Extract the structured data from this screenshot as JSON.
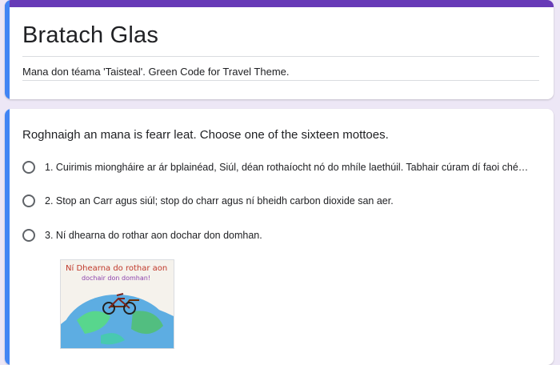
{
  "header": {
    "title": "Bratach Glas",
    "description": "Mana don téama 'Taisteal'. Green Code for Travel Theme."
  },
  "question": {
    "title": "Roghnaigh an mana is fearr leat. Choose one of the sixteen mottoes.",
    "options": [
      {
        "label": "1. Cuirimis miongháire ar ár bplainéad, Siúl, déan rothaíocht nó do mhíle laethúil. Tabhair cúram dí faoi ché…"
      },
      {
        "label": "2. Stop an Carr agus siúl; stop do charr agus ní bheidh carbon dioxide san aer."
      },
      {
        "label": "3. Ní dhearna do rothar aon dochar don domhan."
      }
    ],
    "image_text": {
      "line1": "Ní Dhearna do rothar aon",
      "line2": "dochair don domhan!"
    }
  },
  "colors": {
    "accent": "#673ab7",
    "focus": "#4285f4",
    "background": "#ede7f6"
  }
}
